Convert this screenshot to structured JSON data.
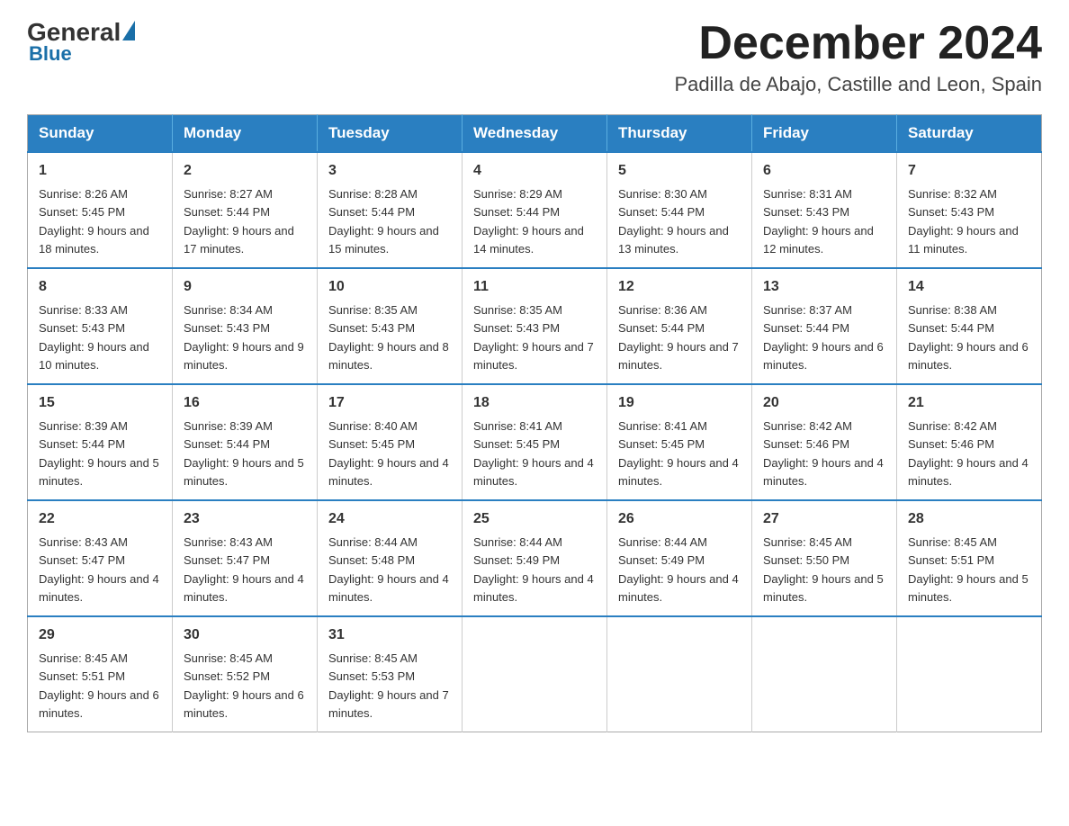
{
  "header": {
    "logo": {
      "general": "General",
      "blue": "Blue"
    },
    "month_title": "December 2024",
    "location": "Padilla de Abajo, Castille and Leon, Spain"
  },
  "days_of_week": [
    "Sunday",
    "Monday",
    "Tuesday",
    "Wednesday",
    "Thursday",
    "Friday",
    "Saturday"
  ],
  "weeks": [
    [
      {
        "day": "1",
        "sunrise": "8:26 AM",
        "sunset": "5:45 PM",
        "daylight": "9 hours and 18 minutes."
      },
      {
        "day": "2",
        "sunrise": "8:27 AM",
        "sunset": "5:44 PM",
        "daylight": "9 hours and 17 minutes."
      },
      {
        "day": "3",
        "sunrise": "8:28 AM",
        "sunset": "5:44 PM",
        "daylight": "9 hours and 15 minutes."
      },
      {
        "day": "4",
        "sunrise": "8:29 AM",
        "sunset": "5:44 PM",
        "daylight": "9 hours and 14 minutes."
      },
      {
        "day": "5",
        "sunrise": "8:30 AM",
        "sunset": "5:44 PM",
        "daylight": "9 hours and 13 minutes."
      },
      {
        "day": "6",
        "sunrise": "8:31 AM",
        "sunset": "5:43 PM",
        "daylight": "9 hours and 12 minutes."
      },
      {
        "day": "7",
        "sunrise": "8:32 AM",
        "sunset": "5:43 PM",
        "daylight": "9 hours and 11 minutes."
      }
    ],
    [
      {
        "day": "8",
        "sunrise": "8:33 AM",
        "sunset": "5:43 PM",
        "daylight": "9 hours and 10 minutes."
      },
      {
        "day": "9",
        "sunrise": "8:34 AM",
        "sunset": "5:43 PM",
        "daylight": "9 hours and 9 minutes."
      },
      {
        "day": "10",
        "sunrise": "8:35 AM",
        "sunset": "5:43 PM",
        "daylight": "9 hours and 8 minutes."
      },
      {
        "day": "11",
        "sunrise": "8:35 AM",
        "sunset": "5:43 PM",
        "daylight": "9 hours and 7 minutes."
      },
      {
        "day": "12",
        "sunrise": "8:36 AM",
        "sunset": "5:44 PM",
        "daylight": "9 hours and 7 minutes."
      },
      {
        "day": "13",
        "sunrise": "8:37 AM",
        "sunset": "5:44 PM",
        "daylight": "9 hours and 6 minutes."
      },
      {
        "day": "14",
        "sunrise": "8:38 AM",
        "sunset": "5:44 PM",
        "daylight": "9 hours and 6 minutes."
      }
    ],
    [
      {
        "day": "15",
        "sunrise": "8:39 AM",
        "sunset": "5:44 PM",
        "daylight": "9 hours and 5 minutes."
      },
      {
        "day": "16",
        "sunrise": "8:39 AM",
        "sunset": "5:44 PM",
        "daylight": "9 hours and 5 minutes."
      },
      {
        "day": "17",
        "sunrise": "8:40 AM",
        "sunset": "5:45 PM",
        "daylight": "9 hours and 4 minutes."
      },
      {
        "day": "18",
        "sunrise": "8:41 AM",
        "sunset": "5:45 PM",
        "daylight": "9 hours and 4 minutes."
      },
      {
        "day": "19",
        "sunrise": "8:41 AM",
        "sunset": "5:45 PM",
        "daylight": "9 hours and 4 minutes."
      },
      {
        "day": "20",
        "sunrise": "8:42 AM",
        "sunset": "5:46 PM",
        "daylight": "9 hours and 4 minutes."
      },
      {
        "day": "21",
        "sunrise": "8:42 AM",
        "sunset": "5:46 PM",
        "daylight": "9 hours and 4 minutes."
      }
    ],
    [
      {
        "day": "22",
        "sunrise": "8:43 AM",
        "sunset": "5:47 PM",
        "daylight": "9 hours and 4 minutes."
      },
      {
        "day": "23",
        "sunrise": "8:43 AM",
        "sunset": "5:47 PM",
        "daylight": "9 hours and 4 minutes."
      },
      {
        "day": "24",
        "sunrise": "8:44 AM",
        "sunset": "5:48 PM",
        "daylight": "9 hours and 4 minutes."
      },
      {
        "day": "25",
        "sunrise": "8:44 AM",
        "sunset": "5:49 PM",
        "daylight": "9 hours and 4 minutes."
      },
      {
        "day": "26",
        "sunrise": "8:44 AM",
        "sunset": "5:49 PM",
        "daylight": "9 hours and 4 minutes."
      },
      {
        "day": "27",
        "sunrise": "8:45 AM",
        "sunset": "5:50 PM",
        "daylight": "9 hours and 5 minutes."
      },
      {
        "day": "28",
        "sunrise": "8:45 AM",
        "sunset": "5:51 PM",
        "daylight": "9 hours and 5 minutes."
      }
    ],
    [
      {
        "day": "29",
        "sunrise": "8:45 AM",
        "sunset": "5:51 PM",
        "daylight": "9 hours and 6 minutes."
      },
      {
        "day": "30",
        "sunrise": "8:45 AM",
        "sunset": "5:52 PM",
        "daylight": "9 hours and 6 minutes."
      },
      {
        "day": "31",
        "sunrise": "8:45 AM",
        "sunset": "5:53 PM",
        "daylight": "9 hours and 7 minutes."
      },
      null,
      null,
      null,
      null
    ]
  ]
}
